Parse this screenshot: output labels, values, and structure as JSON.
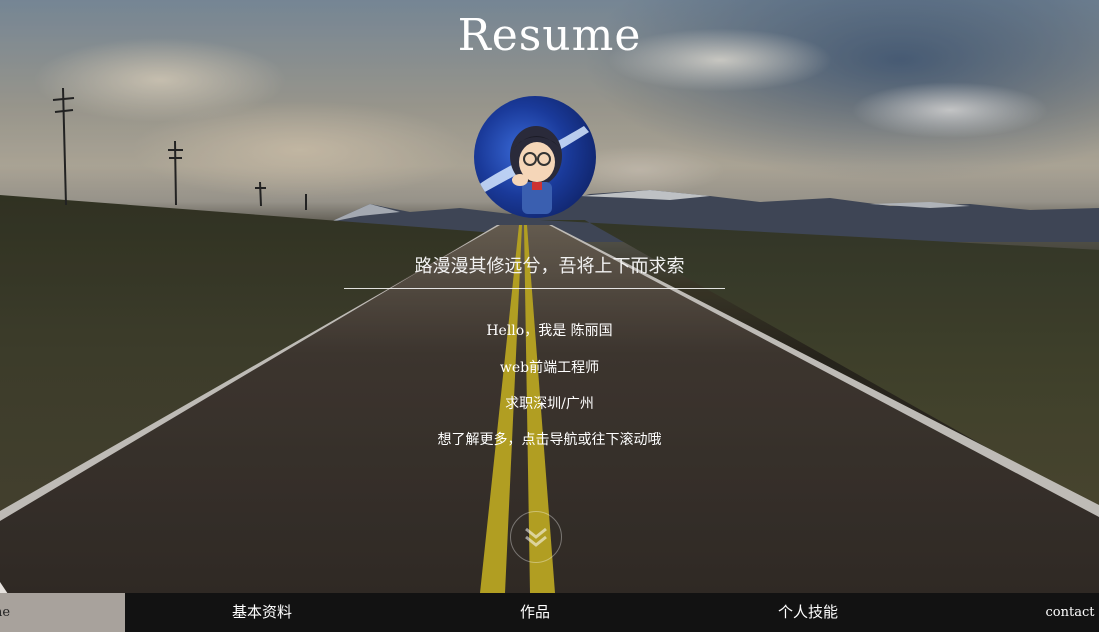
{
  "title": "Resume",
  "avatar_icon": "anime-avatar-icon",
  "motto": "路漫漫其修远兮，吾将上下而求索",
  "intro": {
    "hello": "Hello，我是 陈丽国",
    "role": "web前端工程师",
    "job": "求职深圳/广州",
    "hint": "想了解更多，点击导航或往下滚动哦"
  },
  "scroll_icon": "double-chevron-down-icon",
  "nav": {
    "home": "me",
    "basic": "基本资料",
    "works": "作品",
    "skills": "个人技能",
    "contact": "contact"
  },
  "colors": {
    "nav_bg": "#121212",
    "nav_active_bg": "#a8a29c",
    "road_line_yellow": "#d8c12a"
  }
}
